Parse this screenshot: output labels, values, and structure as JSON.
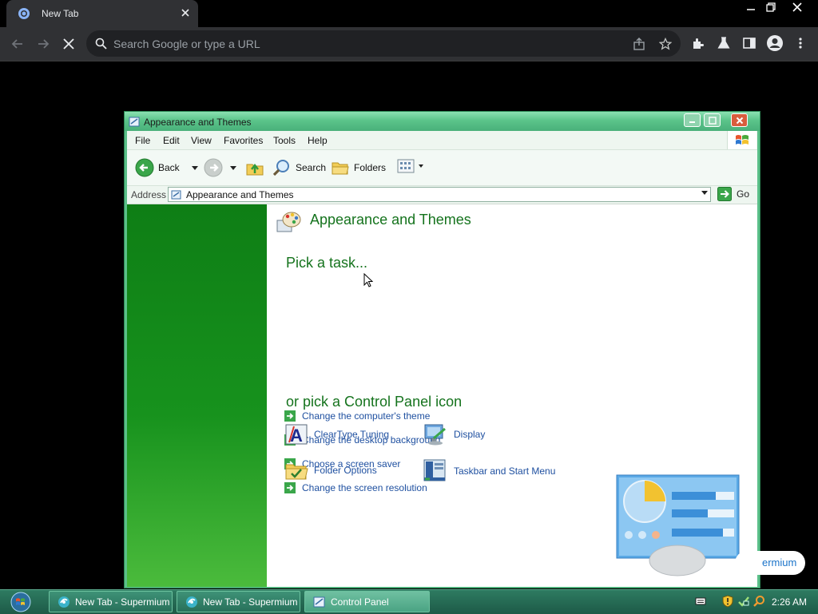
{
  "browser": {
    "tab_title": "New Tab",
    "omnibox_placeholder": "Search Google or type a URL"
  },
  "window": {
    "title": "Appearance and Themes",
    "menu": [
      "File",
      "Edit",
      "View",
      "Favorites",
      "Tools",
      "Help"
    ],
    "toolbar": {
      "back_label": "Back",
      "search_label": "Search",
      "folders_label": "Folders"
    },
    "address": {
      "label": "Address",
      "value": "Appearance and Themes",
      "go_label": "Go"
    },
    "content": {
      "heading": "Appearance and Themes",
      "pick_task": "Pick a task...",
      "tasks": [
        "Change the computer's theme",
        "Change the desktop background",
        "Choose a screen saver",
        "Change the screen resolution"
      ],
      "or_pick": "or pick a Control Panel icon",
      "icons": [
        {
          "label": "ClearType Tuning",
          "icon": "cleartype-icon"
        },
        {
          "label": "Display",
          "icon": "display-icon"
        },
        {
          "label": "Folder Options",
          "icon": "folder-options-icon"
        },
        {
          "label": "Taskbar and Start Menu",
          "icon": "taskbar-start-menu-icon"
        }
      ]
    }
  },
  "popup": {
    "text": "ermium"
  },
  "taskbar": {
    "buttons": [
      "New Tab - Supermium",
      "New Tab - Supermium",
      "Control Panel"
    ],
    "clock": "2:26 AM"
  },
  "colors": {
    "xp_title_green": "#5bc48a",
    "left_pane_green": "#17921d",
    "heading_green": "#15731d",
    "link_blue": "#1f50a0",
    "taskbar_green": "#2e7b61"
  }
}
